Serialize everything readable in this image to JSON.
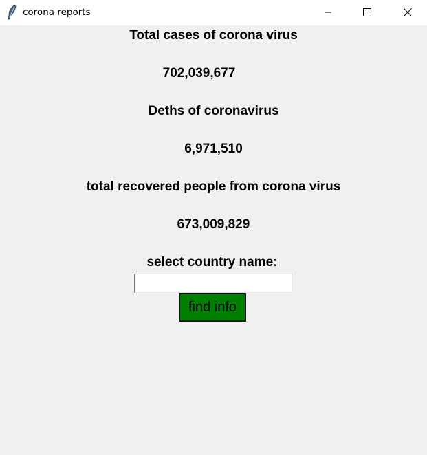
{
  "window": {
    "title": "corona reports",
    "icon": "feather-icon"
  },
  "titlebar_buttons": {
    "minimize_icon": "minimize-icon",
    "maximize_icon": "maximize-icon",
    "close_icon": "close-icon"
  },
  "stats": {
    "total_cases_label": "Total cases of corona virus",
    "total_cases_value": "702,039,677",
    "deaths_label": "Deths of coronavirus",
    "deaths_value": "6,971,510",
    "recovered_label": "total recovered people from corona virus",
    "recovered_value": "673,009,829"
  },
  "search": {
    "label": "select country name:",
    "value": "",
    "button_label": "find info"
  },
  "colors": {
    "background": "#f0f0f0",
    "button_bg": "#008000"
  }
}
